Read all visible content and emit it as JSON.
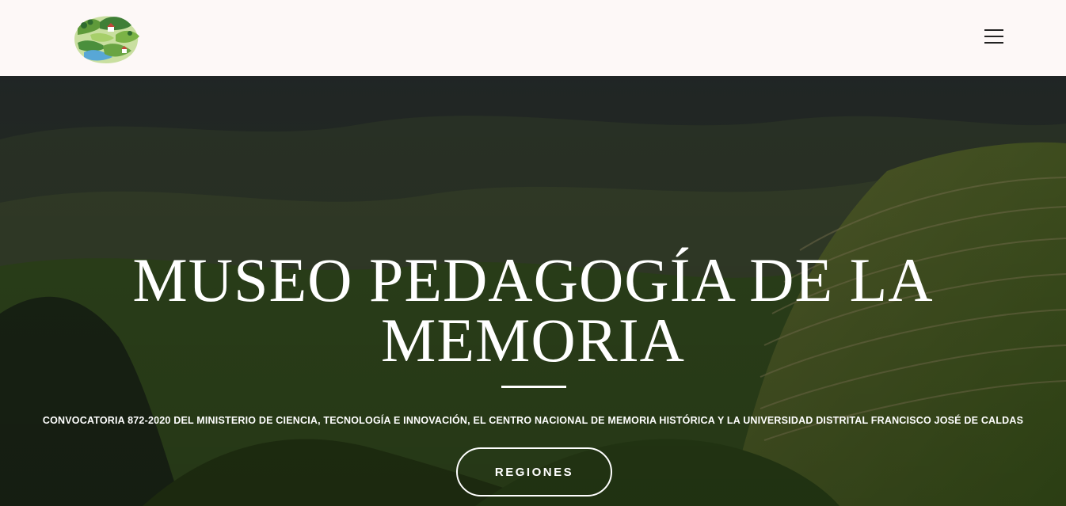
{
  "header": {
    "logo_icon": "landscape-logo-icon",
    "menu_icon": "hamburger-menu-icon"
  },
  "hero": {
    "title": "MUSEO PEDAGOGÍA DE LA MEMORIA",
    "subtitle": "CONVOCATORIA 872-2020 DEL MINISTERIO DE CIENCIA, TECNOLOGÍA E INNOVACIÓN, EL CENTRO NACIONAL DE MEMORIA HISTÓRICA Y LA UNIVERSIDAD DISTRITAL FRANCISCO JOSÉ DE CALDAS",
    "button_label": "REGIONES"
  },
  "colors": {
    "nav_background": "#fdf8f7",
    "hero_text": "#ffffff",
    "menu_icon": "#222222"
  }
}
